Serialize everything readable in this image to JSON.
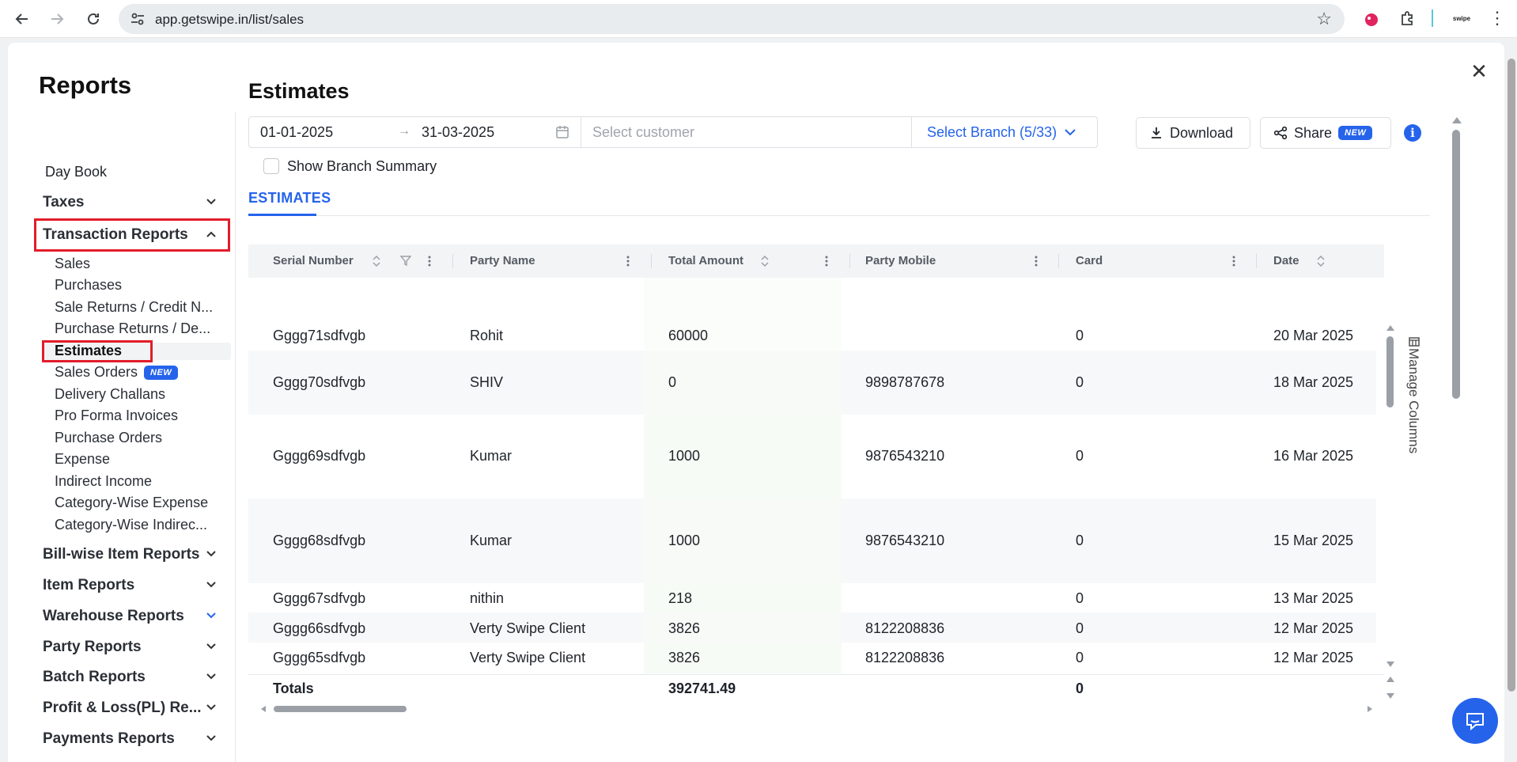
{
  "browser": {
    "url": "app.getswipe.in/list/sales",
    "ext_label": "swipe"
  },
  "modal": {
    "title": "Reports",
    "close": "✕"
  },
  "sidebar": {
    "day_book": "Day Book",
    "groups": {
      "taxes": "Taxes",
      "transaction_reports": "Transaction Reports",
      "bill_wise": "Bill-wise Item Reports",
      "item_reports": "Item Reports",
      "warehouse_reports": "Warehouse Reports",
      "party_reports": "Party Reports",
      "batch_reports": "Batch Reports",
      "profit_loss": "Profit & Loss(PL) Re...",
      "payments_reports": "Payments Reports"
    },
    "sub_items": {
      "sales": "Sales",
      "purchases": "Purchases",
      "sale_returns": "Sale Returns / Credit N...",
      "purchase_returns": "Purchase Returns / De...",
      "estimates": "Estimates",
      "sales_orders": "Sales Orders",
      "delivery_challans": "Delivery Challans",
      "pro_forma": "Pro Forma Invoices",
      "purchase_orders": "Purchase Orders",
      "expense": "Expense",
      "indirect_income": "Indirect Income",
      "category_expense": "Category-Wise Expense",
      "category_indirect": "Category-Wise Indirec..."
    },
    "new_badge": "NEW",
    "highlight_color": "#e21c2a"
  },
  "main": {
    "title": "Estimates",
    "date_from": "01-01-2025",
    "date_to": "31-03-2025",
    "customer_placeholder": "Select customer",
    "branch": "Select Branch (5/33)",
    "show_branch_summary": "Show Branch Summary",
    "download": "Download",
    "share": "Share",
    "share_badge": "NEW",
    "tab": "ESTIMATES",
    "manage_columns": "Manage Columns",
    "accent": "#2563eb"
  },
  "table": {
    "headers": {
      "serial": "Serial Number",
      "party": "Party Name",
      "amount": "Total Amount",
      "mobile": "Party Mobile",
      "card": "Card",
      "date": "Date"
    },
    "rows": [
      {
        "serial": "Gggg71sdfvgb",
        "party": "Rohit",
        "amount": "60000",
        "mobile": "",
        "card": "0",
        "date": "20 Mar 2025"
      },
      {
        "serial": "Gggg70sdfvgb",
        "party": "SHIV",
        "amount": "0",
        "mobile": "9898787678",
        "card": "0",
        "date": "18 Mar 2025"
      },
      {
        "serial": "Gggg69sdfvgb",
        "party": "Kumar",
        "amount": "1000",
        "mobile": "9876543210",
        "card": "0",
        "date": "16 Mar 2025"
      },
      {
        "serial": "Gggg68sdfvgb",
        "party": "Kumar",
        "amount": "1000",
        "mobile": "9876543210",
        "card": "0",
        "date": "15 Mar 2025"
      },
      {
        "serial": "Gggg67sdfvgb",
        "party": "nithin",
        "amount": "218",
        "mobile": "",
        "card": "0",
        "date": "13 Mar 2025"
      },
      {
        "serial": "Gggg66sdfvgb",
        "party": "Verty Swipe Client",
        "amount": "3826",
        "mobile": "8122208836",
        "card": "0",
        "date": "12 Mar 2025"
      },
      {
        "serial": "Gggg65sdfvgb",
        "party": "Verty Swipe Client",
        "amount": "3826",
        "mobile": "8122208836",
        "card": "0",
        "date": "12 Mar 2025"
      }
    ],
    "totals": {
      "label": "Totals",
      "amount": "392741.49",
      "card": "0"
    }
  }
}
